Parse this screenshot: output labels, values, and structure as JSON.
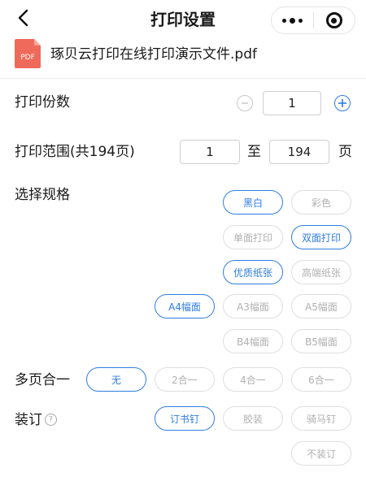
{
  "nav": {
    "title": "打印设置"
  },
  "file": {
    "icon_text": "PDF",
    "name": "琢贝云打印在线打印演示文件.pdf"
  },
  "copies": {
    "label": "打印份数",
    "value": "1"
  },
  "range": {
    "label": "打印范围(共194页)",
    "from": "1",
    "to_label": "至",
    "to": "194",
    "unit": "页"
  },
  "spec": {
    "label": "选择规格",
    "color": [
      {
        "label": "黑白",
        "selected": true
      },
      {
        "label": "彩色",
        "selected": false
      }
    ],
    "sides": [
      {
        "label": "单面打印",
        "selected": false
      },
      {
        "label": "双面打印",
        "selected": true
      }
    ],
    "paper": [
      {
        "label": "优质纸张",
        "selected": true
      },
      {
        "label": "高端纸张",
        "selected": false
      }
    ],
    "size": [
      {
        "label": "A4幅面",
        "selected": true
      },
      {
        "label": "A3幅面",
        "selected": false
      },
      {
        "label": "A5幅面",
        "selected": false
      },
      {
        "label": "B4幅面",
        "selected": false
      },
      {
        "label": "B5幅面",
        "selected": false
      }
    ]
  },
  "multipage": {
    "label": "多页合一",
    "options": [
      {
        "label": "无",
        "selected": true
      },
      {
        "label": "2合一",
        "selected": false
      },
      {
        "label": "4合一",
        "selected": false
      },
      {
        "label": "6合一",
        "selected": false
      }
    ]
  },
  "binding": {
    "label": "装订",
    "help_icon": "?",
    "options": [
      {
        "label": "订书钉",
        "selected": true
      },
      {
        "label": "胶装",
        "selected": false
      },
      {
        "label": "骑马钉",
        "selected": false
      },
      {
        "label": "不装订",
        "selected": false
      }
    ]
  },
  "colors": {
    "accent": "#2f7de1",
    "pdf_red": "#ef6a5a",
    "chip_border": "#dedede",
    "chip_text": "#b0b0b0"
  },
  "icons": [
    "back-arrow-icon",
    "more-dots-icon",
    "target-close-icon",
    "pdf-file-icon",
    "minus-circle-icon",
    "plus-circle-icon",
    "question-icon"
  ]
}
